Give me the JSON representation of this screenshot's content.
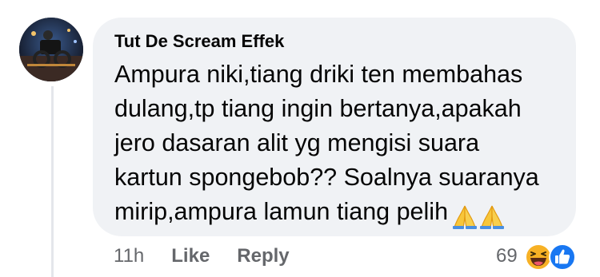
{
  "comment": {
    "author": "Tut De Scream Effek",
    "text": "Ampura niki,tiang driki ten membahas\ndulang,tp tiang ingin bertanya,apakah\njero dasaran alit yg mengisi suara\nkartun spongebob?? Soalnya suaranya\nmirip,ampura lamun tiang pelih",
    "emoji": [
      "folded-hands-icon",
      "folded-hands-icon"
    ]
  },
  "actions": {
    "time": "11h",
    "like_label": "Like",
    "reply_label": "Reply"
  },
  "reactions": {
    "count": "69",
    "types": [
      "haha-icon",
      "like-icon"
    ]
  },
  "colors": {
    "bubble_bg": "#f0f2f5",
    "muted_text": "#65676b",
    "like_blue": "#1877f2",
    "haha_yellow": "#f7b125"
  }
}
